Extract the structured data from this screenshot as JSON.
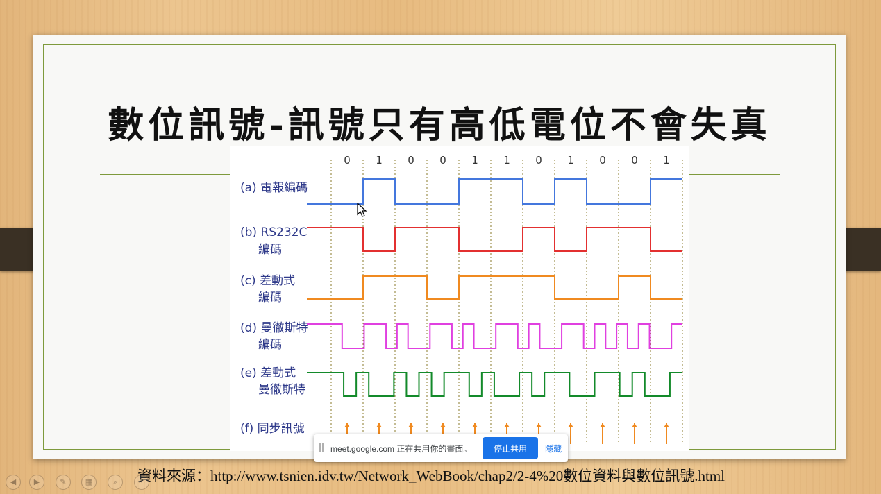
{
  "slide": {
    "title": "數位訊號-訊號只有高低電位不會失真",
    "source": "資料來源：http://www.tsnien.idv.tw/Network_WebBook/chap2/2-4%20數位資料與數位訊號.html"
  },
  "chart_data": {
    "type": "line",
    "title": "",
    "bits": [
      "0",
      "1",
      "0",
      "0",
      "1",
      "1",
      "0",
      "1",
      "0",
      "0",
      "1"
    ],
    "series": [
      {
        "name": "(a) 電報編碼",
        "label_lines": [
          "(a) 電報編碼"
        ],
        "color": "#4477dd",
        "levels": [
          0,
          1,
          0,
          0,
          1,
          1,
          0,
          1,
          0,
          0,
          1
        ]
      },
      {
        "name": "(b) RS232C 編碼",
        "label_lines": [
          "(b) RS232C",
          "編碼"
        ],
        "color": "#e33030",
        "levels": [
          1,
          0,
          1,
          1,
          0,
          0,
          1,
          0,
          1,
          1,
          0
        ]
      },
      {
        "name": "(c) 差動式 編碼",
        "label_lines": [
          "(c) 差動式",
          "編碼"
        ],
        "color": "#f08a20",
        "levels": [
          0,
          1,
          1,
          0,
          1,
          1,
          1,
          0,
          0,
          1,
          0
        ]
      },
      {
        "name": "(d) 曼徹斯特 編碼",
        "label_lines": [
          "(d) 曼徹斯特",
          "編碼"
        ],
        "color": "#e040e0",
        "levels": [
          1,
          0,
          0,
          1,
          1,
          0,
          1,
          0,
          0,
          1,
          1,
          0,
          1,
          0,
          0,
          1,
          1,
          0,
          1,
          0,
          0,
          1,
          1,
          0,
          1,
          0,
          1,
          0,
          1,
          0,
          0,
          1
        ]
      },
      {
        "name": "(e) 差動式 曼徹斯特",
        "label_lines": [
          "(e) 差動式",
          "曼徹斯特"
        ],
        "color": "#138a2a",
        "levels": [
          1,
          0,
          1,
          0,
          0,
          1,
          0,
          1,
          0,
          1,
          1,
          0,
          1,
          0,
          0,
          1,
          0,
          1,
          1,
          0,
          0,
          1,
          1,
          0,
          1,
          0,
          0,
          1
        ]
      },
      {
        "name": "(f) 同步訊號",
        "label_lines": [
          "(f) 同步訊號"
        ],
        "color": "#f08a20",
        "type": "clock"
      }
    ]
  },
  "share_bar": {
    "message": "meet.google.com 正在共用你的畫面。",
    "stop_label": "停止共用",
    "hide_label": "隱藏"
  },
  "controls": {
    "prev_icon": "prev-icon",
    "next_icon": "next-icon",
    "pen_icon": "pen-icon",
    "slides_icon": "slides-icon",
    "zoom_icon": "zoom-icon"
  }
}
